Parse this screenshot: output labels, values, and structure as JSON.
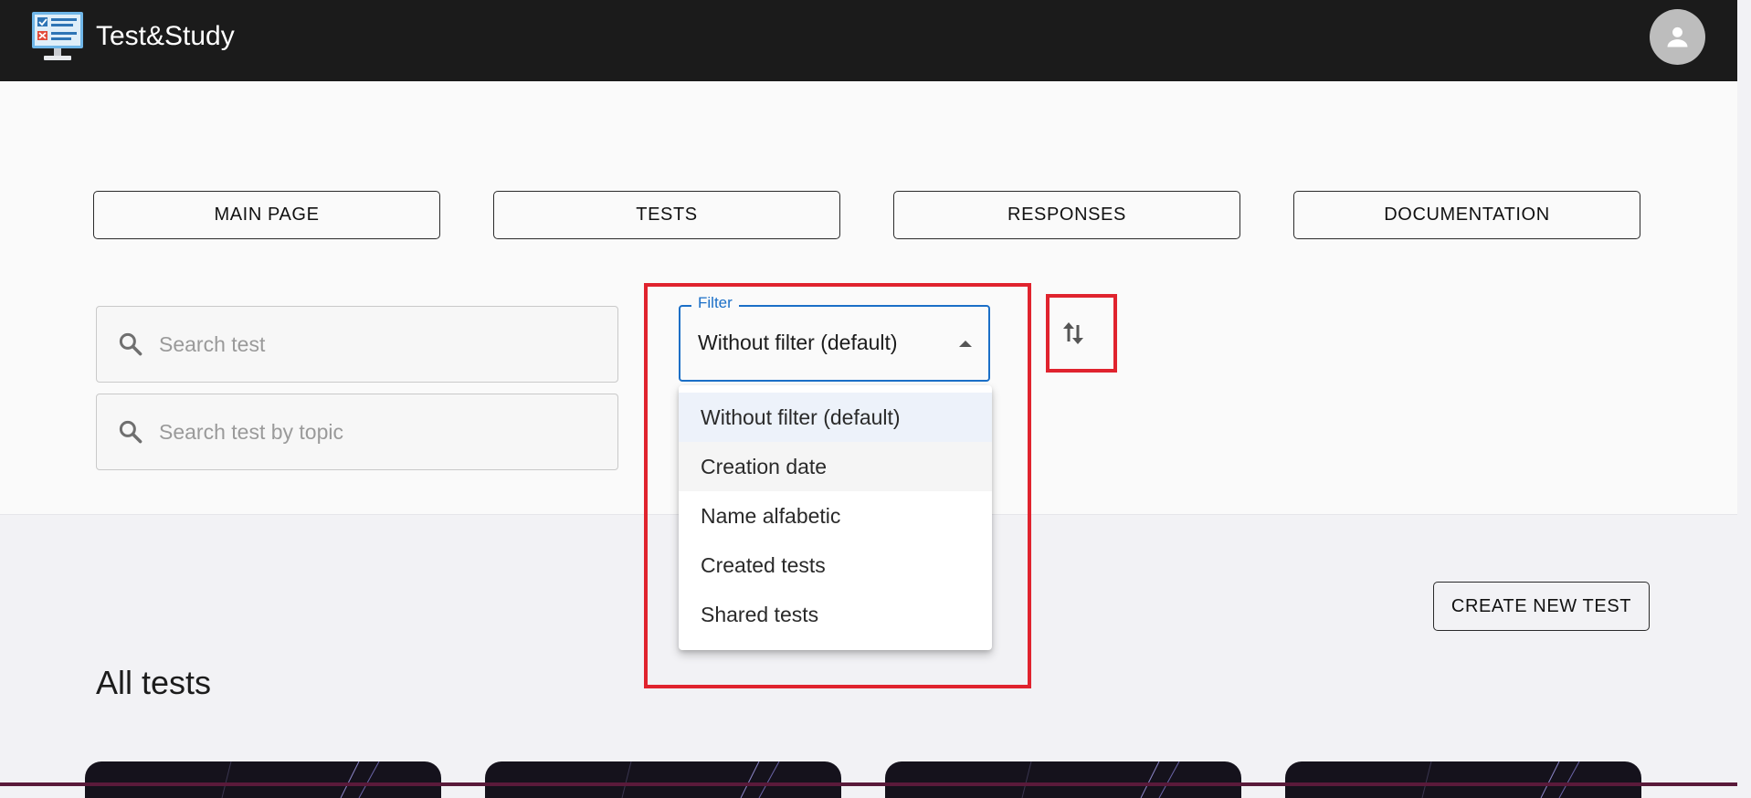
{
  "app": {
    "brand": "Test&Study"
  },
  "nav": [
    {
      "label": "MAIN PAGE"
    },
    {
      "label": "TESTS"
    },
    {
      "label": "RESPONSES"
    },
    {
      "label": "DOCUMENTATION"
    }
  ],
  "search": {
    "test_placeholder": "Search test",
    "topic_placeholder": "Search test by topic"
  },
  "filter": {
    "label": "Filter",
    "value": "Without filter (default)",
    "options": [
      "Without filter (default)",
      "Creation date",
      "Name alfabetic",
      "Created tests",
      "Shared tests"
    ],
    "selected_index": 0,
    "hover_index": 1
  },
  "actions": {
    "create_new_test": "CREATE NEW TEST"
  },
  "section": {
    "title": "All tests"
  },
  "colors": {
    "topbar": "#1b1b1b",
    "accent_blue": "#1b6fc7",
    "highlight_red": "#e0232e",
    "page_bg": "#fafafa"
  },
  "icons": [
    "app-logo-icon",
    "account-icon",
    "search-icon",
    "dropdown-caret-icon",
    "sort-icon"
  ]
}
